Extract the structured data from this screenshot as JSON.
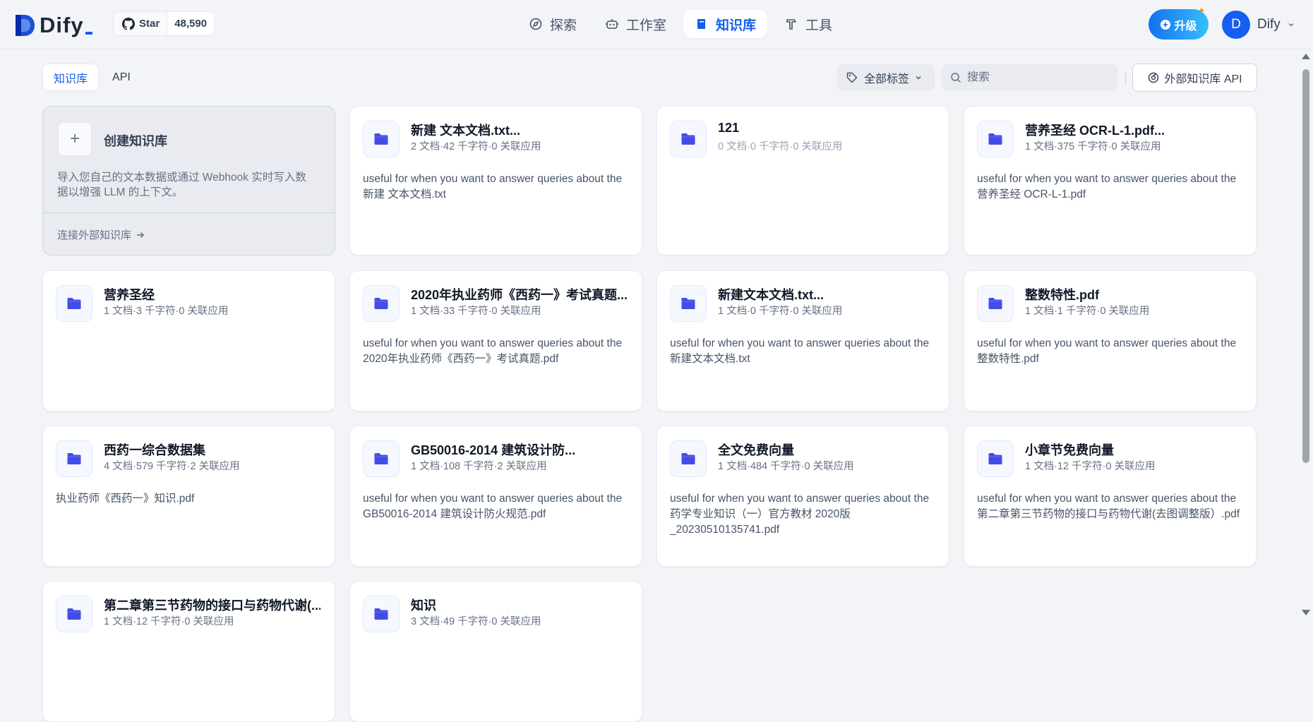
{
  "app": {
    "brand": "Dify",
    "github": {
      "star_label": "Star",
      "star_count": "48,590"
    },
    "nav": [
      {
        "label": "探索",
        "icon": "compass-icon",
        "active": false
      },
      {
        "label": "工作室",
        "icon": "robot-icon",
        "active": false
      },
      {
        "label": "知识库",
        "icon": "book-icon",
        "active": true
      },
      {
        "label": "工具",
        "icon": "hammer-icon",
        "active": false
      }
    ],
    "upgrade_label": "升级",
    "user": {
      "initial": "D",
      "name": "Dify"
    }
  },
  "toolbar": {
    "tabs": [
      {
        "label": "知识库",
        "active": true
      },
      {
        "label": "API",
        "active": false
      }
    ],
    "tag_filter_label": "全部标签",
    "search_placeholder": "搜索",
    "external_api_label": "外部知识库 API"
  },
  "create_card": {
    "title": "创建知识库",
    "description": "导入您自己的文本数据或通过 Webhook 实时写入数据以增强 LLM 的上下文。",
    "link_label": "连接外部知识库"
  },
  "datasets": [
    {
      "name": "新建 文本文档.txt...",
      "meta": "2 文档·42 千字符·0 关联应用",
      "description": "useful for when you want to answer queries about the 新建 文本文档.txt"
    },
    {
      "name": "121",
      "meta": "0 文档·0 千字符·0 关联应用",
      "description": ""
    },
    {
      "name": "营养圣经 OCR-L-1.pdf...",
      "meta": "1 文档·375 千字符·0 关联应用",
      "description": "useful for when you want to answer queries about the 营养圣经 OCR-L-1.pdf"
    },
    {
      "name": "营养圣经",
      "meta": "1 文档·3 千字符·0 关联应用",
      "description": ""
    },
    {
      "name": "2020年执业药师《西药一》考试真题...",
      "meta": "1 文档·33 千字符·0 关联应用",
      "description": "useful for when you want to answer queries about the 2020年执业药师《西药一》考试真题.pdf"
    },
    {
      "name": "新建文本文档.txt...",
      "meta": "1 文档·0 千字符·0 关联应用",
      "description": "useful for when you want to answer queries about the 新建文本文档.txt"
    },
    {
      "name": "整数特性.pdf",
      "meta": "1 文档·1 千字符·0 关联应用",
      "description": "useful for when you want to answer queries about the 整数特性.pdf"
    },
    {
      "name": "西药一综合数据集",
      "meta": "4 文档·579 千字符·2 关联应用",
      "description": "执业药师《西药一》知识.pdf"
    },
    {
      "name": "GB50016-2014 建筑设计防...",
      "meta": "1 文档·108 千字符·2 关联应用",
      "description": "useful for when you want to answer queries about the GB50016-2014 建筑设计防火规范.pdf"
    },
    {
      "name": "全文免费向量",
      "meta": "1 文档·484 千字符·0 关联应用",
      "description": "useful for when you want to answer queries about the 药学专业知识（一）官方教材 2020版 _20230510135741.pdf"
    },
    {
      "name": "小章节免费向量",
      "meta": "1 文档·12 千字符·0 关联应用",
      "description": "useful for when you want to answer queries about the 第二章第三节药物的接口与药物代谢(去图调整版）.pdf"
    },
    {
      "name": "第二章第三节药物的接口与药物代谢(...",
      "meta": "1 文档·12 千字符·0 关联应用",
      "description": ""
    },
    {
      "name": "知识",
      "meta": "3 文档·49 千字符·0 关联应用",
      "description": ""
    }
  ]
}
